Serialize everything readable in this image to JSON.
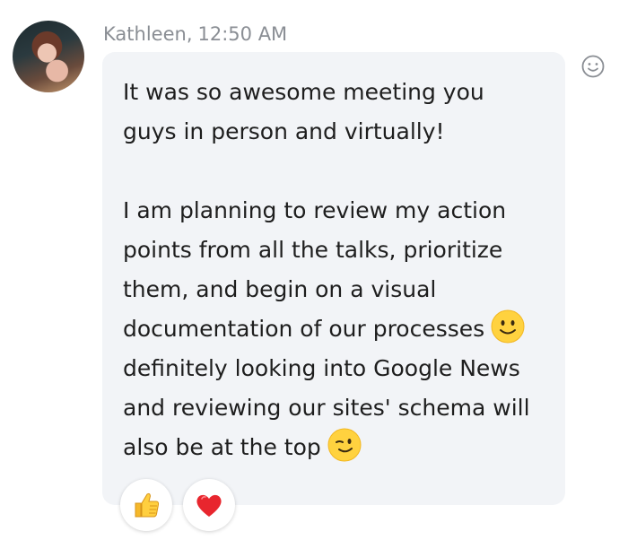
{
  "message": {
    "sender": "Kathleen",
    "time": "12:50 AM",
    "paragraph1": "It was so awesome meeting you guys in person and virtually!",
    "paragraph2_part1": "I am planning to review my action points from all the talks, prioritize them, and begin on a visual documentation of our processes",
    "paragraph2_part2": "definitely looking into Google News and reviewing our sites' schema will also be at the top",
    "emoji_1": "smile-emoji",
    "emoji_2": "wink-emoji"
  },
  "reactions": [
    {
      "icon": "thumbs-up-icon"
    },
    {
      "icon": "heart-icon"
    }
  ],
  "actions": {
    "add_reaction_icon": "smiley-outline-icon"
  },
  "colors": {
    "bubble": "#f2f4f7",
    "meta_text": "#8a8e94",
    "body_text": "#1e1e1e",
    "heart": "#e8262e",
    "emoji_yellow": "#ffd23f"
  }
}
